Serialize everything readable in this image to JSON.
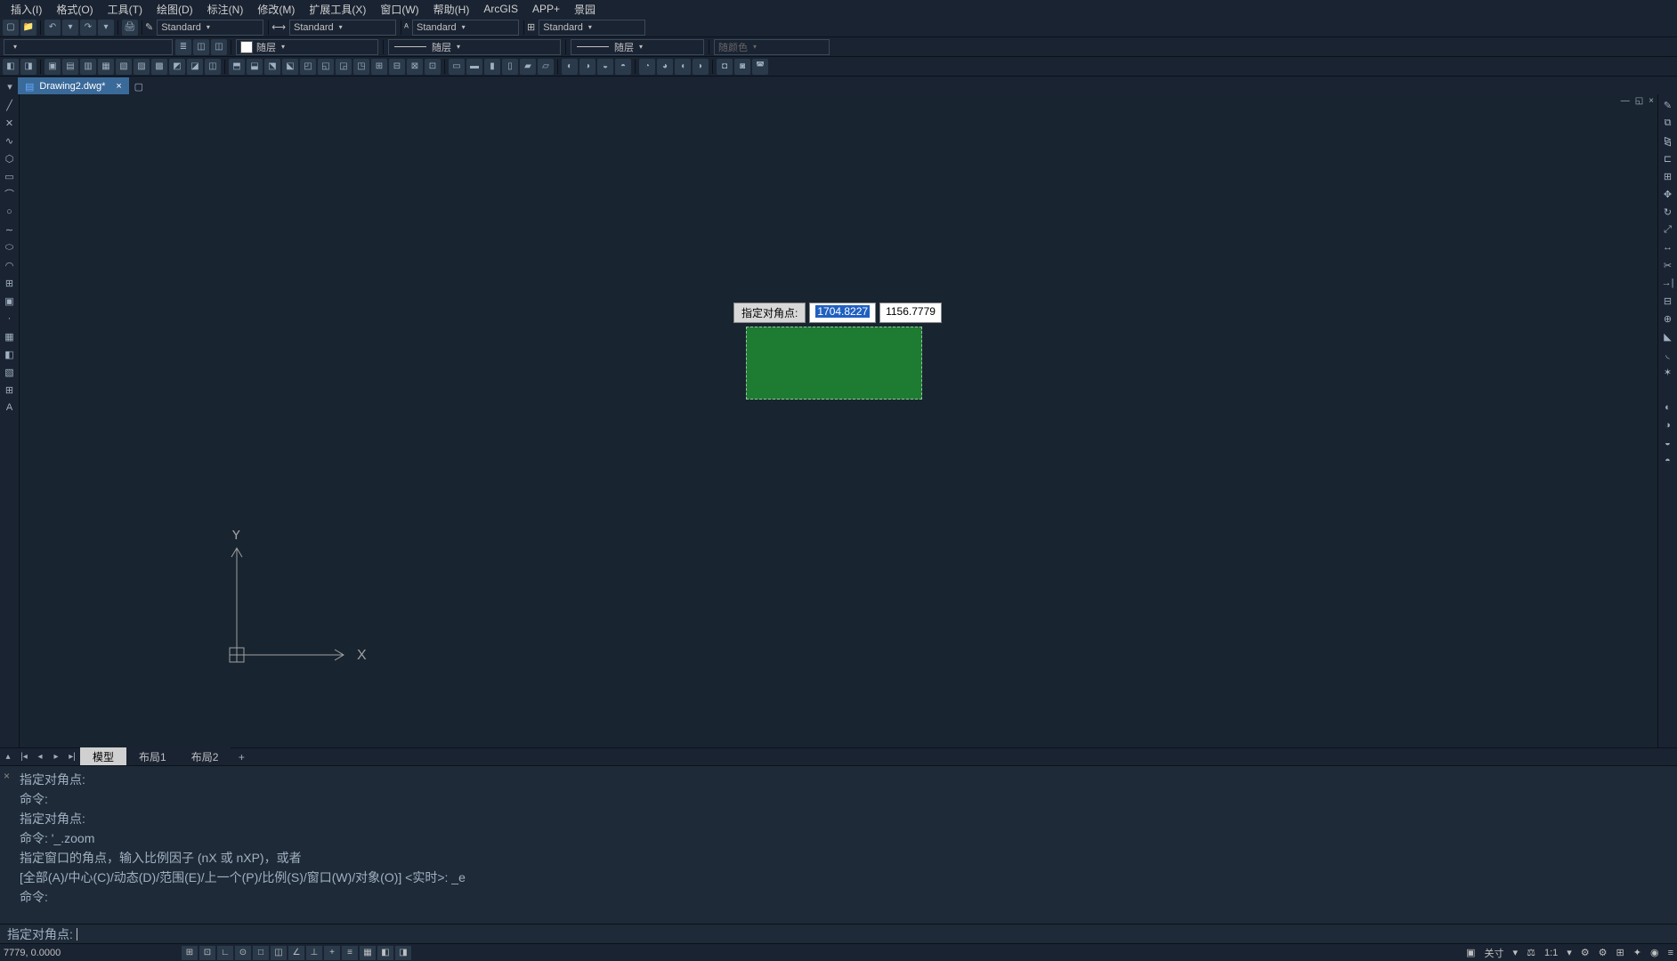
{
  "menu": {
    "insert": "插入(I)",
    "format": "格式(O)",
    "tools": "工具(T)",
    "draw": "绘图(D)",
    "annotate": "标注(N)",
    "modify": "修改(M)",
    "extend": "扩展工具(X)",
    "window": "窗口(W)",
    "help": "帮助(H)",
    "arcgis": "ArcGIS",
    "app": "APP+",
    "garden": "景园"
  },
  "toolbar1": {
    "style_standard": "Standard",
    "dim_standard": "Standard",
    "text_standard": "Standard",
    "table_standard": "Standard"
  },
  "toolbar2": {
    "color_bylayer": "随层",
    "linetype_bylayer": "随层",
    "lineweight_bylayer": "随层",
    "plotstyle_bycolor": "随颜色"
  },
  "filetab": {
    "name": "Drawing2.dwg*"
  },
  "dyn_input": {
    "label": "指定对角点:",
    "value1": "1704.8227",
    "value2": "1156.7779"
  },
  "layout_tabs": {
    "model": "模型",
    "layout1": "布局1",
    "layout2": "布局2",
    "add": "+"
  },
  "command_history": [
    "指定对角点:",
    "命令:",
    "指定对角点:",
    "命令: '_.zoom",
    "指定窗口的角点，输入比例因子 (nX 或 nXP)，或者",
    "[全部(A)/中心(C)/动态(D)/范围(E)/上一个(P)/比例(S)/窗口(W)/对象(O)] <实时>: _e",
    "命令:"
  ],
  "command_prompt": "指定对角点:",
  "statusbar": {
    "coords": "7779, 0.0000",
    "annoscale": "关寸",
    "scale": "1:1"
  }
}
